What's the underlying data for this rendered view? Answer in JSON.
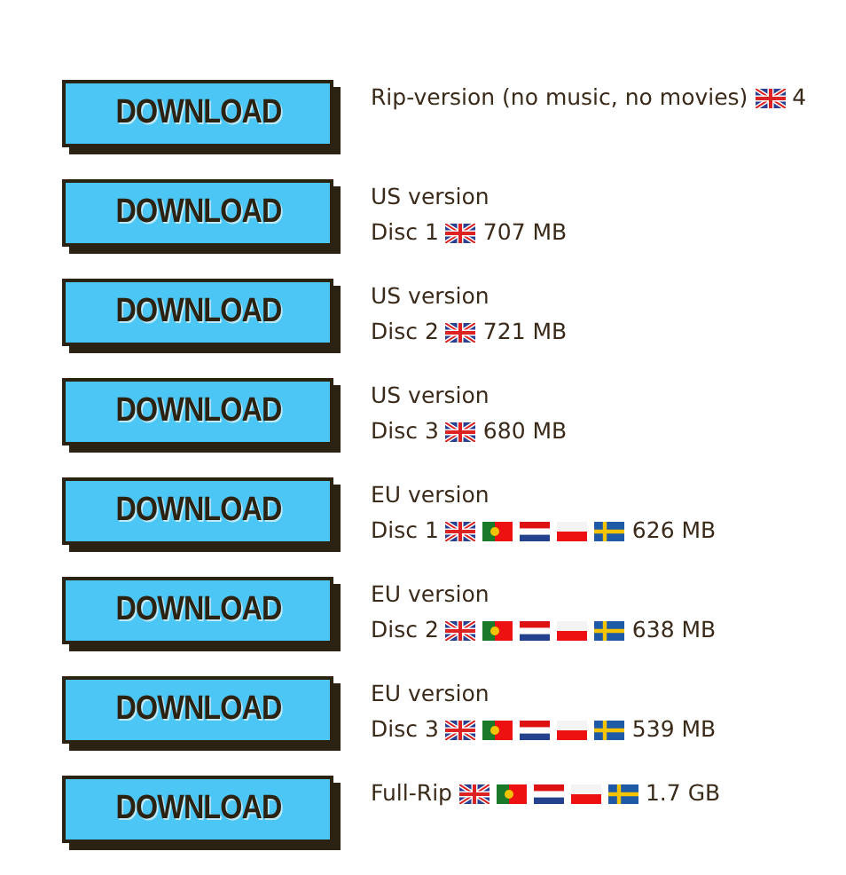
{
  "downloads": [
    {
      "button": "DOWNLOAD",
      "lines": [
        {
          "label": "Rip-version (no music, no movies)",
          "flags": [
            {
              "kind": "uk"
            }
          ],
          "size": "4"
        }
      ]
    },
    {
      "button": "DOWNLOAD",
      "lines": [
        {
          "label": "US version"
        },
        {
          "label": "Disc 1",
          "flags": [
            {
              "kind": "uk"
            }
          ],
          "size": "707 MB"
        }
      ]
    },
    {
      "button": "DOWNLOAD",
      "lines": [
        {
          "label": "US version"
        },
        {
          "label": "Disc 2",
          "flags": [
            {
              "kind": "uk"
            }
          ],
          "size": "721 MB"
        }
      ]
    },
    {
      "button": "DOWNLOAD",
      "lines": [
        {
          "label": "US version"
        },
        {
          "label": "Disc 3",
          "flags": [
            {
              "kind": "uk"
            }
          ],
          "size": "680 MB"
        }
      ]
    },
    {
      "button": "DOWNLOAD",
      "lines": [
        {
          "label": "EU version"
        },
        {
          "label": "Disc 1",
          "flags": [
            {
              "kind": "uk"
            },
            {
              "kind": "pt"
            },
            {
              "kind": "nl"
            },
            {
              "kind": "pl"
            },
            {
              "kind": "se"
            }
          ],
          "size": "626 MB"
        }
      ]
    },
    {
      "button": "DOWNLOAD",
      "lines": [
        {
          "label": "EU version"
        },
        {
          "label": "Disc 2",
          "flags": [
            {
              "kind": "uk"
            },
            {
              "kind": "pt"
            },
            {
              "kind": "nl"
            },
            {
              "kind": "pl"
            },
            {
              "kind": "se"
            }
          ],
          "size": "638 MB"
        }
      ]
    },
    {
      "button": "DOWNLOAD",
      "lines": [
        {
          "label": "EU version"
        },
        {
          "label": "Disc 3",
          "flags": [
            {
              "kind": "uk"
            },
            {
              "kind": "pt"
            },
            {
              "kind": "nl"
            },
            {
              "kind": "pl"
            },
            {
              "kind": "se"
            }
          ],
          "size": "539 MB"
        }
      ]
    },
    {
      "button": "DOWNLOAD",
      "lines": [
        {
          "label": "Full-Rip",
          "flags": [
            {
              "kind": "uk"
            },
            {
              "kind": "pt"
            },
            {
              "kind": "nl"
            },
            {
              "kind": "pl"
            },
            {
              "kind": "se"
            }
          ],
          "size": "1.7 GB"
        }
      ]
    }
  ]
}
